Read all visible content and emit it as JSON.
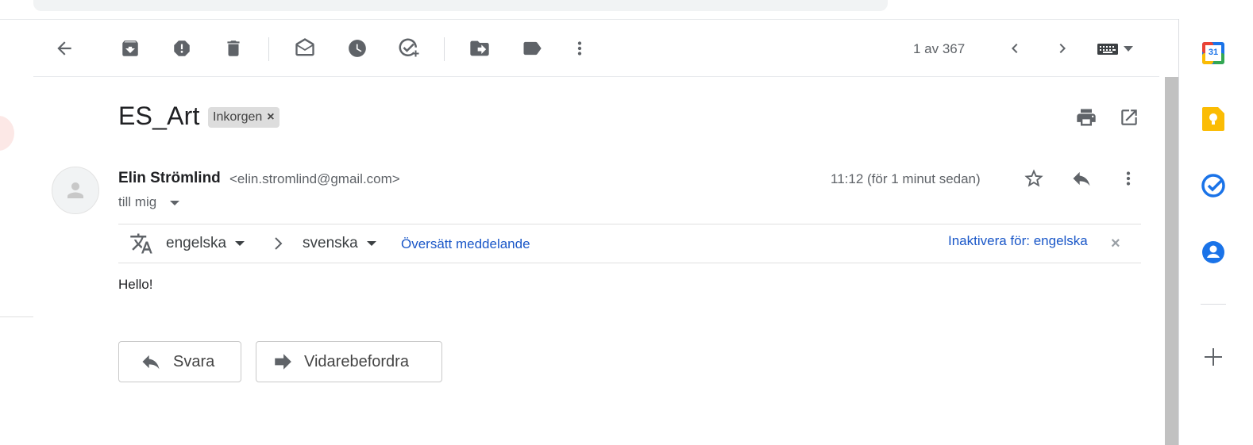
{
  "toolbar": {
    "icons": [
      "back-icon",
      "archive-icon",
      "report-spam-icon",
      "delete-icon",
      "mark-unread-icon",
      "snooze-icon",
      "add-to-tasks-icon",
      "move-to-icon",
      "label-icon",
      "more-vert-icon"
    ],
    "pager": "1 av 367",
    "input_tools": "keyboard-icon"
  },
  "message": {
    "subject": "ES_Art",
    "label": "Inkorgen",
    "label_remove": "×",
    "sender_name": "Elin Strömlind",
    "sender_email": "<elin.stromlind@gmail.com>",
    "recipient": "till mig",
    "timestamp": "11:12 (för 1 minut sedan)",
    "body": "Hello!"
  },
  "translate": {
    "from_lang": "engelska",
    "arrow": "›",
    "to_lang": "svenska",
    "translate_link": "Översätt meddelande",
    "disable_link": "Inaktivera för: engelska",
    "close": "×"
  },
  "actions": {
    "reply": "Svara",
    "forward": "Vidarebefordra"
  },
  "side_panel": {
    "calendar_day": "31",
    "apps": [
      "calendar-icon",
      "keep-icon",
      "tasks-icon",
      "contacts-icon",
      "add-addon-icon"
    ]
  },
  "colors": {
    "link": "#1a57c8",
    "calendar_blue": "#1a73e8",
    "keep_yellow": "#fbbc04",
    "tasks_blue": "#1a73e8",
    "contacts_blue": "#1a73e8"
  }
}
